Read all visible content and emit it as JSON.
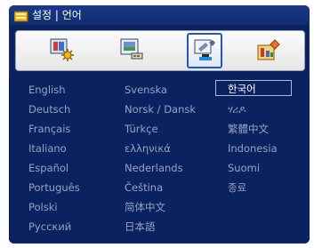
{
  "title": {
    "text": "설정 | 언어"
  },
  "tabs": [
    {
      "name": "settings-image-tab",
      "selected": false
    },
    {
      "name": "settings-display-tab",
      "selected": false
    },
    {
      "name": "settings-setup-tab",
      "selected": true
    },
    {
      "name": "settings-advanced-tab",
      "selected": false
    }
  ],
  "languages": {
    "col1": [
      "English",
      "Deutsch",
      "Français",
      "Italiano",
      "Español",
      "Português",
      "Polski",
      "Русский"
    ],
    "col2": [
      "Svenska",
      "Norsk / Dansk",
      "Türkçe",
      "ελληνικά",
      "Nederlands",
      "Čeština",
      "简体中文",
      "日本語"
    ],
    "col3": [
      "한국어",
      "ሃሪዶ",
      "繁體中文",
      "Indonesia",
      "Suomi",
      "종료"
    ]
  },
  "selected_language": "한국어",
  "colors": {
    "background": "#0b2260",
    "text_dim": "#95a2c6",
    "text_selected": "#ffffff",
    "tab_highlight": "#1f57c7"
  }
}
